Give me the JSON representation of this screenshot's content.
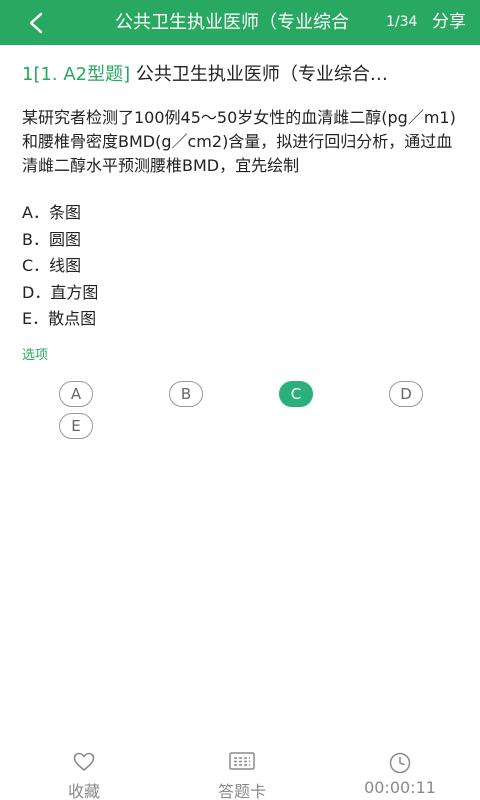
{
  "header": {
    "title": "公共卫生执业医师（专业综合",
    "progress": "1/34",
    "share_label": "分享"
  },
  "question": {
    "number": "1",
    "type_tag": "[1. A2型题]",
    "heading_text": "公共卫生执业医师（专业综合…",
    "stem": "某研究者检测了100例45～50岁女性的血清雌二醇(pg／m1)和腰椎骨密度BMD(g／cm2)含量，拟进行回归分析，通过血清雌二醇水平预测腰椎BMD，宜先绘制",
    "options": [
      {
        "letter": "A",
        "text": "A．条图"
      },
      {
        "letter": "B",
        "text": "B．圆图"
      },
      {
        "letter": "C",
        "text": "C．线图"
      },
      {
        "letter": "D",
        "text": "D．直方图"
      },
      {
        "letter": "E",
        "text": "E．散点图"
      }
    ]
  },
  "answer": {
    "section_label": "选项",
    "choices": [
      "A",
      "B",
      "C",
      "D",
      "E"
    ],
    "selected": "C"
  },
  "bottom_bar": {
    "favorite_label": "收藏",
    "answer_card_label": "答题卡",
    "timer": "00:00:11"
  },
  "colors": {
    "brand_green": "#28a860",
    "selected_green": "#2ab07a"
  }
}
